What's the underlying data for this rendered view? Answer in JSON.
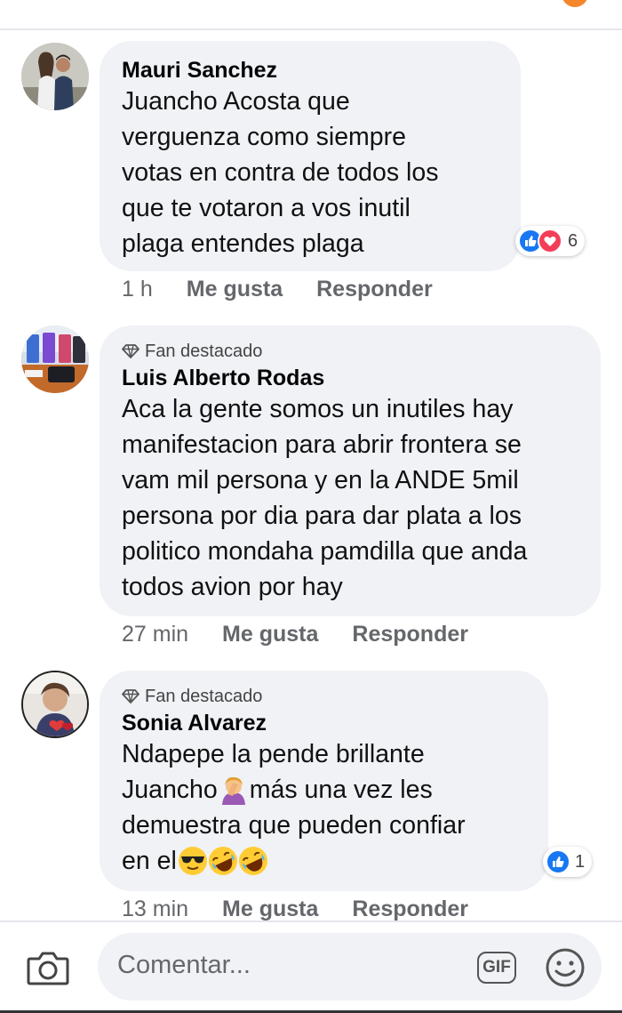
{
  "composer": {
    "placeholder": "Comentar...",
    "gif_label": "GIF"
  },
  "comments": [
    {
      "author": "Mauri Sanchez",
      "badge": "",
      "text": "Juancho Acosta que\nverguenza como siempre\nvotas en contra de todos los\nque te votaron a vos inutil\nplaga entendes plaga",
      "reactions": {
        "types": [
          "like",
          "love"
        ],
        "count": "6"
      },
      "time": "1 h",
      "like_label": "Me gusta",
      "reply_label": "Responder"
    },
    {
      "author": "Luis Alberto Rodas",
      "badge": "Fan destacado",
      "text": "Aca la gente somos un inutiles hay\nmanifestacion para abrir frontera se\nvam mil persona y en la ANDE 5mil\npersona por dia para dar plata a los\npolitico mondaha pamdilla que anda\ntodos avion por hay",
      "time": "27 min",
      "like_label": "Me gusta",
      "reply_label": "Responder"
    },
    {
      "author": "Sonia Alvarez",
      "badge": "Fan destacado",
      "text_line1": "Ndapepe la pende brillante",
      "text_line2a": "Juancho",
      "text_line2b": "más una vez les",
      "text_line3": "demuestra que pueden confiar",
      "text_line4": "en el",
      "emoji": [
        "facepalm-emoji",
        "sunglasses-emoji",
        "rofl-emoji",
        "rofl-emoji"
      ],
      "reactions": {
        "types": [
          "like"
        ],
        "count": "1"
      },
      "time": "13 min",
      "like_label": "Me gusta",
      "reply_label": "Responder"
    }
  ],
  "colors": {
    "bubble": "#f0f2f5",
    "like": "#1877f2",
    "love": "#f33e58",
    "meta": "#65676b"
  }
}
